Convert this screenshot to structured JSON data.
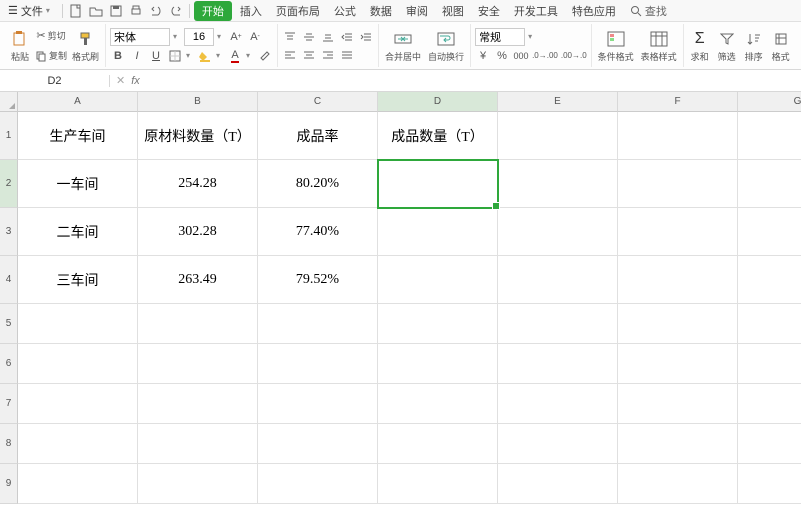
{
  "menubar": {
    "file_label": "文件",
    "tabs": [
      "开始",
      "插入",
      "页面布局",
      "公式",
      "数据",
      "审阅",
      "视图",
      "安全",
      "开发工具",
      "特色应用"
    ],
    "active_tab": 0,
    "search_label": "查找"
  },
  "ribbon": {
    "paste": "粘贴",
    "cut": "剪切",
    "copy": "复制",
    "format_painter": "格式刷",
    "font_name": "宋体",
    "font_size": "16",
    "merge_center": "合并居中",
    "auto_wrap": "自动换行",
    "number_format": "常规",
    "cond_format": "条件格式",
    "table_style": "表格样式",
    "sum": "求和",
    "filter": "筛选",
    "sort": "排序",
    "format": "格式"
  },
  "namebox": {
    "cell_ref": "D2",
    "fx": "fx"
  },
  "grid": {
    "col_headers": [
      "A",
      "B",
      "C",
      "D",
      "E",
      "F",
      "G"
    ],
    "row_headers": [
      "1",
      "2",
      "3",
      "4",
      "5",
      "6",
      "7",
      "8",
      "9"
    ],
    "active_col": "D",
    "active_row": "2",
    "data": [
      [
        "生产车间",
        "原材料数量（T）",
        "成品率",
        "成品数量（T）",
        "",
        "",
        ""
      ],
      [
        "一车间",
        "254.28",
        "80.20%",
        "",
        "",
        "",
        ""
      ],
      [
        "二车间",
        "302.28",
        "77.40%",
        "",
        "",
        "",
        ""
      ],
      [
        "三车间",
        "263.49",
        "79.52%",
        "",
        "",
        "",
        ""
      ],
      [
        "",
        "",
        "",
        "",
        "",
        "",
        ""
      ],
      [
        "",
        "",
        "",
        "",
        "",
        "",
        ""
      ],
      [
        "",
        "",
        "",
        "",
        "",
        "",
        ""
      ],
      [
        "",
        "",
        "",
        "",
        "",
        "",
        ""
      ],
      [
        "",
        "",
        "",
        "",
        "",
        "",
        ""
      ]
    ],
    "selected": {
      "row": 1,
      "col": 3
    }
  }
}
